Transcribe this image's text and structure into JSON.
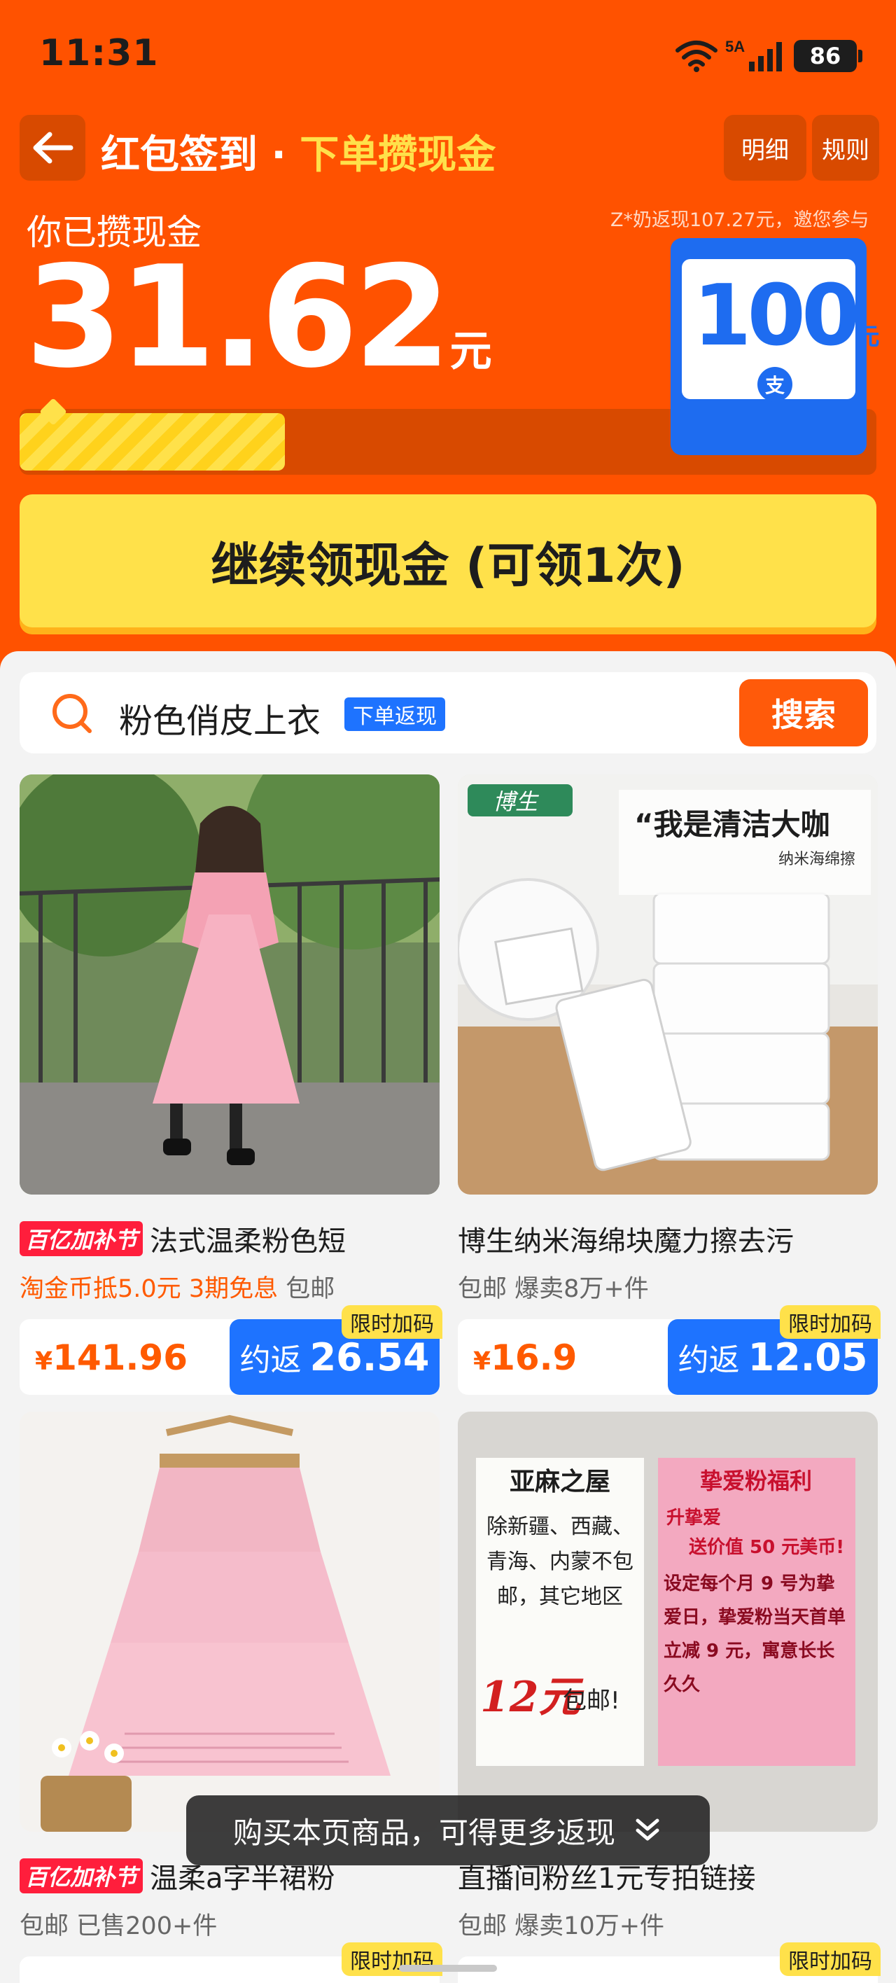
{
  "status_bar": {
    "time": "11:31",
    "network": "5A",
    "battery": "86"
  },
  "header": {
    "title_main": "红包签到 · ",
    "title_accent": "下单攒现金",
    "detail_label": "明细",
    "rules_label": "规则"
  },
  "savings": {
    "label": "你已攒现金",
    "amount": "31.62",
    "unit": "元",
    "progress": 0.31,
    "promo_text": "Z*奶返现107.27元，邀您参与"
  },
  "coupon": {
    "amount": "100",
    "unit": "元",
    "logo_char": "支"
  },
  "cta_label": "继续领现金 (可领1次)",
  "search": {
    "query": "粉色俏皮上衣",
    "badge": "下单返现",
    "button": "搜索"
  },
  "products": [
    {
      "tag": "百亿加补节",
      "title": "法式温柔粉色短",
      "meta": [
        "淘金币抵5.0元",
        "3期免息",
        "包邮"
      ],
      "price": "141.96",
      "currency": "¥",
      "rebate_label": "约返",
      "rebate": "26.54",
      "limit_tag": "限时加码"
    },
    {
      "tag": "",
      "title": "博生纳米海绵块魔力擦去污",
      "meta": [
        "包邮",
        "爆卖8万+件"
      ],
      "price": "16.9",
      "currency": "¥",
      "rebate_label": "约返",
      "rebate": "12.05",
      "limit_tag": "限时加码",
      "image_text": {
        "brand": "博生",
        "headline": "“我是清洁大咖",
        "sub": "纳米海绵擦"
      }
    },
    {
      "tag": "百亿加补节",
      "title": "温柔a字半裙粉",
      "meta": [
        "包邮",
        "已售200+件"
      ],
      "limit_tag": "限时加码"
    },
    {
      "tag": "",
      "title": "直播间粉丝1元专拍链接",
      "meta": [
        "包邮",
        "爆卖10万+件"
      ],
      "limit_tag": "限时加码",
      "image_text": {
        "left_title": "亚麻之屋",
        "left_body": "除新疆、西藏、青海、内蒙不包邮，其它地区",
        "left_price": "12元",
        "left_suffix": "包邮!",
        "right_title": "挚爱粉福利",
        "right_l1": "升挚爱",
        "right_l2": "送价值 50 元美币!",
        "right_body": "设定每个月 9 号为挚爱日，挚爱粉当天首单立减 9 元，寓意长长久久"
      }
    }
  ],
  "toast": "购买本页商品，可得更多返现"
}
